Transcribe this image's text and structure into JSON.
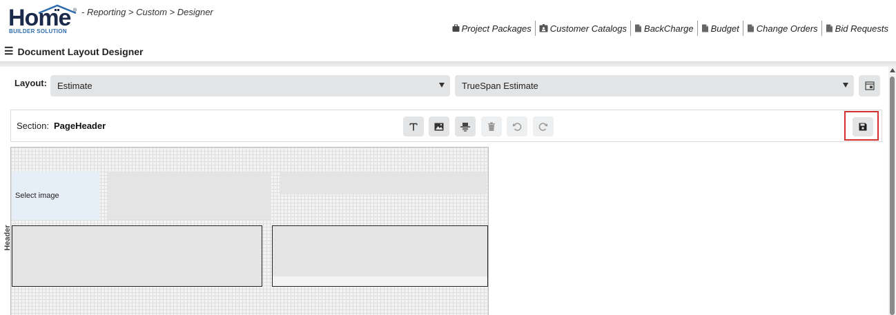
{
  "app": {
    "logo_text": "Home",
    "logo_subtext": "BUILDER SOLUTION",
    "logo_mark": "®"
  },
  "breadcrumb": "- Reporting > Custom > Designer",
  "topnav": {
    "items": [
      {
        "label": "Project Packages",
        "icon": "briefcase-icon"
      },
      {
        "label": "Customer Catalogs",
        "icon": "catalog-icon"
      },
      {
        "label": "BackCharge",
        "icon": "document-icon"
      },
      {
        "label": "Budget",
        "icon": "document-icon"
      },
      {
        "label": "Change Orders",
        "icon": "document-icon"
      },
      {
        "label": "Bid Requests",
        "icon": "document-icon"
      }
    ]
  },
  "page": {
    "title": "Document Layout Designer"
  },
  "layout": {
    "label": "Layout:",
    "type_selected": "Estimate",
    "template_selected": "TrueSpan Estimate"
  },
  "section": {
    "label": "Section:",
    "value": "PageHeader",
    "tools": [
      {
        "name": "text-tool-button",
        "icon": "text-icon",
        "enabled": true
      },
      {
        "name": "image-tool-button",
        "icon": "image-icon",
        "enabled": true
      },
      {
        "name": "field-tool-button",
        "icon": "field-icon",
        "enabled": true
      },
      {
        "name": "delete-button",
        "icon": "trash-icon",
        "enabled": false
      },
      {
        "name": "undo-button",
        "icon": "undo-icon",
        "enabled": false
      },
      {
        "name": "redo-button",
        "icon": "redo-icon",
        "enabled": false
      }
    ],
    "save_icon": "save-icon",
    "highlight_color": "#d32f2f"
  },
  "canvas": {
    "band_label": "Header",
    "image_placeholder": "Select image"
  },
  "colors": {
    "control_bg": "#e3e4e6",
    "brand_dark": "#1b2a4a",
    "brand_blue": "#2b6cb0"
  }
}
